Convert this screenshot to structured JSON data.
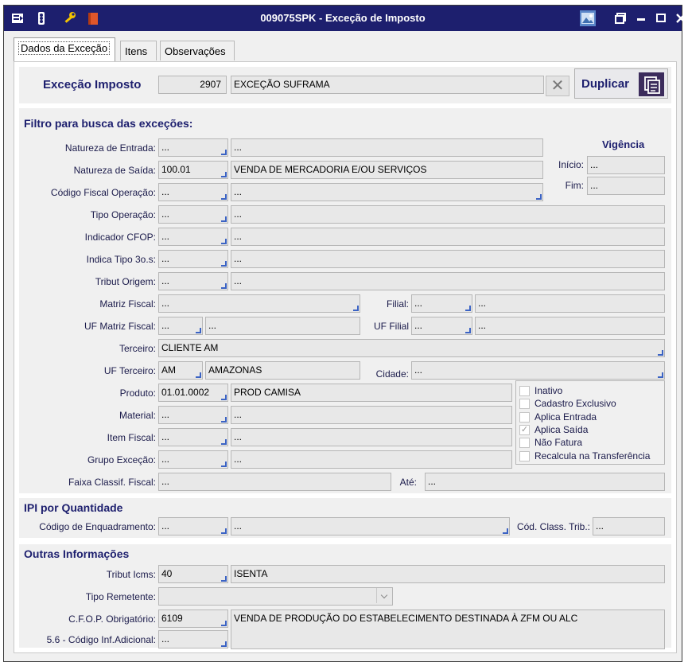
{
  "window": {
    "title": "009075SPK - Exceção de Imposto",
    "icons": [
      "list-icon",
      "traffic-light-icon",
      "wrench-icon",
      "book-icon"
    ]
  },
  "tabs": [
    {
      "label": "Dados da Exceção",
      "active": true
    },
    {
      "label": "Itens",
      "active": false
    },
    {
      "label": "Observações",
      "active": false
    }
  ],
  "header": {
    "label": "Exceção Imposto",
    "code": "2907",
    "description": "EXCEÇÃO SUFRAMA",
    "duplicate_label": "Duplicar"
  },
  "filtro": {
    "title": "Filtro para busca das exceções:",
    "vigencia_title": "Vigência",
    "inicio_label": "Início:",
    "inicio_value": "...",
    "fim_label": "Fim:",
    "fim_value": "...",
    "natureza_entrada": {
      "label": "Natureza de Entrada:",
      "code": "...",
      "desc": "..."
    },
    "natureza_saida": {
      "label": "Natureza de Saída:",
      "code": "100.01",
      "desc": "VENDA DE MERCADORIA E/OU SERVIÇOS"
    },
    "cfop": {
      "label": "Código Fiscal Operação:",
      "code": "...",
      "desc": "..."
    },
    "tipo_operacao": {
      "label": "Tipo Operação:",
      "code": "...",
      "desc": "..."
    },
    "indicador_cfop": {
      "label": "Indicador CFOP:",
      "code": "...",
      "desc": "..."
    },
    "indica_tipo": {
      "label": "Indica Tipo 3o.s:",
      "code": "...",
      "desc": "..."
    },
    "tribut_origem": {
      "label": "Tribut Origem:",
      "code": "...",
      "desc": "..."
    },
    "matriz_fiscal": {
      "label": "Matriz Fiscal:",
      "value": "..."
    },
    "filial": {
      "label": "Filial:",
      "code": "...",
      "desc": "..."
    },
    "uf_matriz": {
      "label": "UF Matriz Fiscal:",
      "code": "...",
      "desc": "..."
    },
    "uf_filial": {
      "label": "UF Filial",
      "code": "...",
      "desc": "..."
    },
    "terceiro": {
      "label": "Terceiro:",
      "value": "CLIENTE AM"
    },
    "uf_terceiro": {
      "label": "UF Terceiro:",
      "code": "AM",
      "desc": "AMAZONAS"
    },
    "cidade": {
      "label": "Cidade:",
      "value": "..."
    },
    "produto": {
      "label": "Produto:",
      "code": "01.01.0002",
      "desc": "PROD CAMISA"
    },
    "material": {
      "label": "Material:",
      "code": "...",
      "desc": "..."
    },
    "item_fiscal": {
      "label": "Item Fiscal:",
      "code": "...",
      "desc": "..."
    },
    "grupo_excecao": {
      "label": "Grupo Exceção:",
      "code": "...",
      "desc": "..."
    },
    "faixa": {
      "label": "Faixa Classif. Fiscal:",
      "value": "..."
    },
    "ate": {
      "label": "Até:",
      "value": "..."
    },
    "checkboxes": [
      {
        "label": "Inativo",
        "checked": false
      },
      {
        "label": "Cadastro Exclusivo",
        "checked": false
      },
      {
        "label": "Aplica Entrada",
        "checked": false
      },
      {
        "label": "Aplica Saída",
        "checked": true
      },
      {
        "label": "Não Fatura",
        "checked": false
      },
      {
        "label": "Recalcula na Transferência",
        "checked": false
      }
    ]
  },
  "ipi": {
    "title": "IPI por Quantidade",
    "enquadramento": {
      "label": "Código de Enquadramento:",
      "code": "...",
      "desc": "..."
    },
    "class_trib": {
      "label": "Cód. Class. Trib.:",
      "value": "..."
    }
  },
  "outras": {
    "title": "Outras Informações",
    "tribut_icms": {
      "label": "Tribut Icms:",
      "code": "40",
      "desc": "ISENTA"
    },
    "tipo_remetente": {
      "label": "Tipo Remetente:",
      "value": ""
    },
    "cfop_obrig": {
      "label": "C.F.O.P. Obrigatório:",
      "code": "6109",
      "desc": "VENDA DE PRODUÇÃO DO ESTABELECIMENTO DESTINADA À ZFM OU ALC"
    },
    "inf_adicional": {
      "label": "5.6 - Código Inf.Adicional:",
      "value": "..."
    }
  }
}
